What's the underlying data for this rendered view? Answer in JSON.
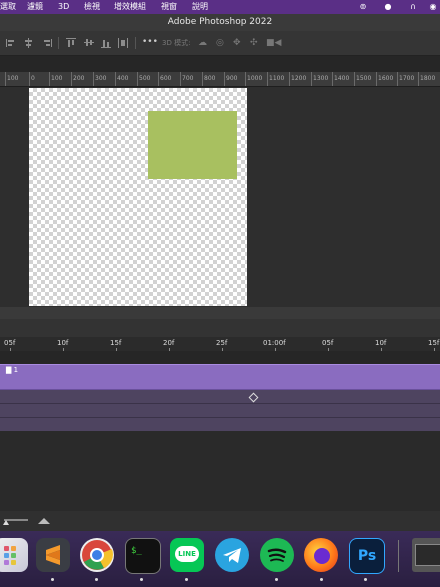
{
  "menubar": {
    "items": [
      "選取",
      "濾鏡",
      "3D",
      "檢視",
      "增效模組",
      "視窗",
      "說明"
    ]
  },
  "window": {
    "title": "Adobe Photoshop 2022"
  },
  "options_bar": {
    "mode_3d_label": "3D 模式:"
  },
  "ruler": {
    "labels": [
      "100",
      "0",
      "100",
      "200",
      "300",
      "400",
      "500",
      "600",
      "700",
      "800",
      "900",
      "1000",
      "1100",
      "1200",
      "1300",
      "1400",
      "1500",
      "1600",
      "1700",
      "1800"
    ]
  },
  "document": {
    "shape_color": "#a8c060",
    "background": "transparent-checkerboard"
  },
  "timeline": {
    "ruler_labels": [
      "05f",
      "10f",
      "15f",
      "20f",
      "25f",
      "01:00f",
      "05f",
      "10f",
      "15f"
    ],
    "track_label": "1",
    "track_color": "#8a6cc0"
  },
  "dock": {
    "apps": [
      "launchpad-icon",
      "sublime-text-icon",
      "chrome-icon",
      "terminal-icon",
      "line-icon",
      "telegram-icon",
      "spotify-icon",
      "firefox-icon",
      "photoshop-icon",
      "window-thumbnail"
    ],
    "terminal_glyph": "$_",
    "line_text": "LINE",
    "ps_text": "Ps"
  }
}
